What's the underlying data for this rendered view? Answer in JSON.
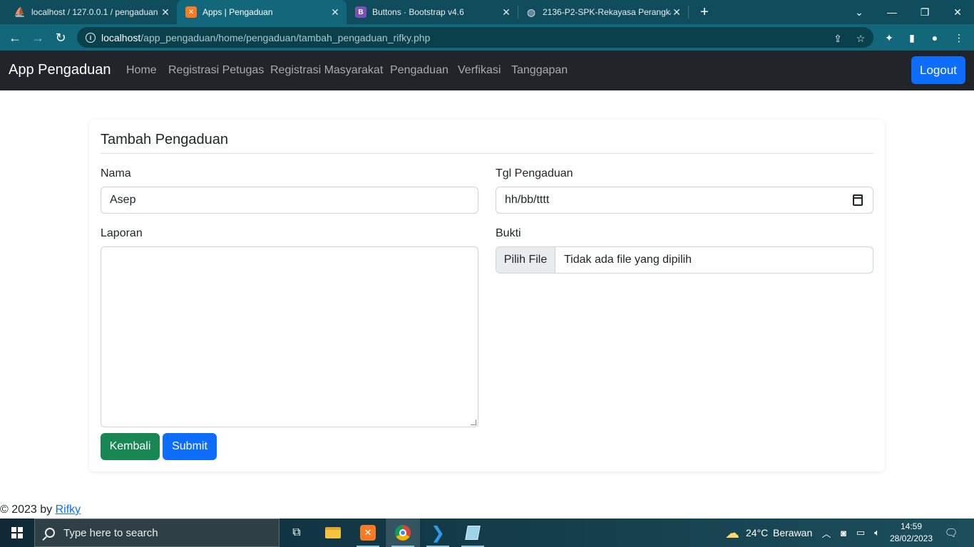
{
  "browser": {
    "tabs": [
      {
        "title": "localhost / 127.0.0.1 / pengaduan",
        "icon": "phpmyadmin-icon",
        "active": false
      },
      {
        "title": "Apps | Pengaduan",
        "icon": "xampp-icon",
        "active": true
      },
      {
        "title": "Buttons · Bootstrap v4.6",
        "icon": "bootstrap-icon",
        "active": false
      },
      {
        "title": "2136-P2-SPK-Rekayasa Perangkat",
        "icon": "globe-icon",
        "active": false
      }
    ],
    "url_host": "localhost",
    "url_path": "/app_pengaduan/home/pengaduan/tambah_pengaduan_rifky.php",
    "accent_color": "#13677b"
  },
  "navbar": {
    "brand": "App Pengaduan",
    "links": [
      "Home",
      "Registrasi Petugas",
      "Registrasi Masyarakat",
      "Pengaduan",
      "Verfikasi",
      "Tanggapan"
    ],
    "logout_label": "Logout"
  },
  "form": {
    "title": "Tambah Pengaduan",
    "nama_label": "Nama",
    "nama_value": "Asep",
    "tgl_label": "Tgl Pengaduan",
    "tgl_placeholder": "hh/bb/tttt",
    "laporan_label": "Laporan",
    "laporan_value": "",
    "bukti_label": "Bukti",
    "file_button": "Pilih File",
    "file_status": "Tidak ada file yang dipilih",
    "back_label": "Kembali",
    "submit_label": "Submit",
    "back_color": "#198754",
    "submit_color": "#0d6efd"
  },
  "footer": {
    "text": "© 2023 by ",
    "link": "Rifky"
  },
  "taskbar": {
    "search_placeholder": "Type here to search",
    "weather_temp": "24°C",
    "weather_desc": "Berawan",
    "time": "14:59",
    "date": "28/02/2023"
  }
}
